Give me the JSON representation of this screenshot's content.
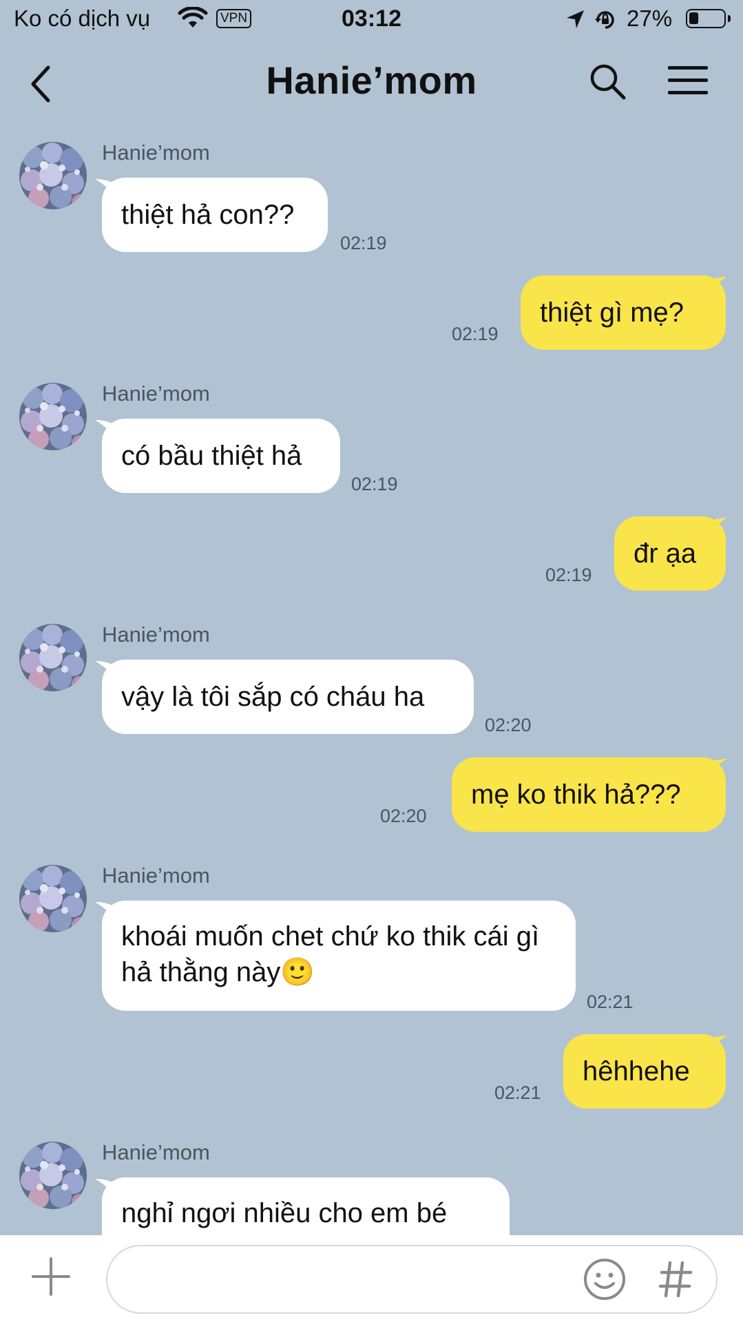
{
  "status": {
    "carrier": "Ko có dịch vụ",
    "vpn": "VPN",
    "time": "03:12",
    "battery": "27%",
    "battery_level": 0.27
  },
  "header": {
    "title": "Hanie’mom"
  },
  "messages": [
    {
      "dir": "in",
      "sender": "Hanie’mom",
      "text": "thiệt hả con??",
      "time": "02:19"
    },
    {
      "dir": "out",
      "text": "thiệt gì mẹ?",
      "time": "02:19"
    },
    {
      "dir": "in",
      "sender": "Hanie’mom",
      "text": "có bầu thiệt hả",
      "time": "02:19"
    },
    {
      "dir": "out",
      "text": "đr ạa",
      "time": "02:19"
    },
    {
      "dir": "in",
      "sender": "Hanie’mom",
      "text": "vậy là tôi sắp có cháu ha",
      "time": "02:20"
    },
    {
      "dir": "out",
      "text": "mẹ ko thik hả???",
      "time": "02:20"
    },
    {
      "dir": "in",
      "sender": "Hanie’mom",
      "text": "khoái muốn chet chứ ko thik cái gì hả thằng này🙂",
      "time": "02:21"
    },
    {
      "dir": "out",
      "text": "hêhhehe",
      "time": "02:21"
    },
    {
      "dir": "in",
      "sender": "Hanie’mom",
      "text": "nghỉ ngơi nhiều cho em bé"
    }
  ],
  "input": {
    "placeholder": "",
    "value": ""
  },
  "colors": {
    "background": "#b1c2d2",
    "incoming_bubble": "#ffffff",
    "outgoing_bubble": "#f9e44a"
  },
  "icons": {
    "back": "chevron-left-icon",
    "search": "search-icon",
    "menu": "hamburger-menu-icon",
    "attach": "plus-icon",
    "emoji": "smiley-icon",
    "hashtag": "hashtag-icon"
  }
}
